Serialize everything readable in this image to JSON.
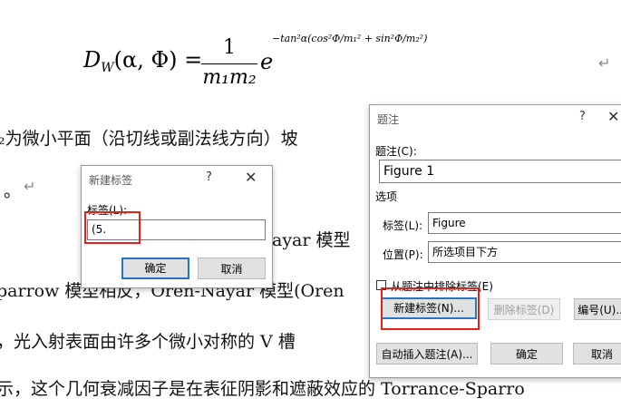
{
  "document": {
    "formula": {
      "lhs_symbol": "D",
      "lhs_sub": "W",
      "lhs_args": "(α, Φ) =",
      "frac_num": "1",
      "frac_den": "m₁m₂",
      "base": "e",
      "exponent": "−tan²α(cos²Φ/m₁² + sin²Φ/m₂²)"
    },
    "return_mark": "↵",
    "lines": [
      "₂为微小平面（沿切线或副法线方向）坡",
      "。",
      "ayar 模型",
      "parrow 模型相反，Oren-Nayar 模型(Oren",
      "，光入射表面由许多个微小对称的 V 槽",
      "示，这个几何衰减因子是在表征阴影和遮蔽效应的 Torrance-Sparro"
    ]
  },
  "new_label_dialog": {
    "title": "新建标签",
    "help": "?",
    "close": "✕",
    "field_label": "标签(L):",
    "field_value": "(5.",
    "ok": "确定",
    "cancel": "取消"
  },
  "caption_dialog": {
    "title": "题注",
    "help": "?",
    "close": "✕",
    "caption_label": "题注(C):",
    "caption_value": "Figure 1",
    "options_heading": "选项",
    "label_label": "标签(L):",
    "label_value": "Figure",
    "position_label": "位置(P):",
    "position_value": "所选项目下方",
    "exclude_label": "从题注中排除标签(E)",
    "new_label_button": "新建标签(N)...",
    "delete_label_button": "删除标签(D)",
    "numbering_button": "编号(U)...",
    "autocaption_button": "自动插入题注(A)...",
    "ok": "确定",
    "cancel": "取消"
  },
  "colors": {
    "highlight": "#e0221d",
    "focus": "#2a74c5"
  }
}
